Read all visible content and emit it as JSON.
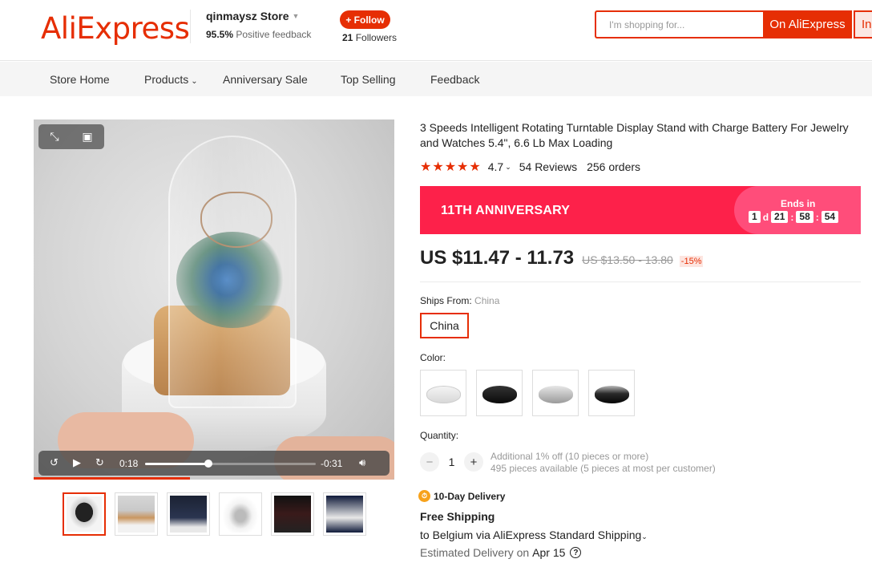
{
  "header": {
    "logo": "AliExpress",
    "store_name": "qinmaysz Store",
    "feedback_percent": "95.5%",
    "feedback_label": "Positive feedback",
    "follow_label": "+ Follow",
    "followers_count": "21",
    "followers_label": "Followers",
    "search_placeholder": "I'm shopping for...",
    "search_button": "On AliExpress",
    "search_button_2": "In"
  },
  "nav": {
    "items": [
      "Store Home",
      "Products",
      "Anniversary Sale",
      "Top Selling",
      "Feedback"
    ]
  },
  "video": {
    "current_time": "0:18",
    "remaining_time": "-0:31",
    "progress": 0.37
  },
  "product": {
    "title": "3 Speeds Intelligent Rotating Turntable Display Stand with Charge Battery For Jewelry and Watches 5.4\", 6.6 Lb Max Loading",
    "rating": "4.7",
    "reviews": "54 Reviews",
    "orders": "256 orders",
    "banner_title": "11TH ANNIVERSARY",
    "ends_in_label": "Ends in",
    "countdown": {
      "days": "1",
      "d_label": "d",
      "hours": "21",
      "minutes": "58",
      "seconds": "54",
      "sep": ":"
    },
    "price": "US $11.47 - 11.73",
    "old_price": "US $13.50 - 13.80",
    "discount": "-15%",
    "ships_from_label": "Ships From:",
    "ships_from_value": "China",
    "ship_option": "China",
    "color_label": "Color:",
    "colors": [
      "white",
      "black",
      "silver",
      "black-silver"
    ],
    "quantity_label": "Quantity:",
    "quantity": "1",
    "qty_minus": "−",
    "qty_plus": "+",
    "qty_info_1": "Additional 1% off (10 pieces or more)",
    "qty_info_2": "495 pieces available (5 pieces at most per customer)",
    "delivery_tag": "10-Day Delivery",
    "free_shipping": "Free Shipping",
    "ship_to": "to Belgium via AliExpress Standard Shipping",
    "estimated_label": "Estimated Delivery on",
    "estimated_date": "Apr 15"
  },
  "colors": {
    "accent": "#e62e04",
    "banner": "#fd214a",
    "banner_pill": "#ff4d7a"
  }
}
